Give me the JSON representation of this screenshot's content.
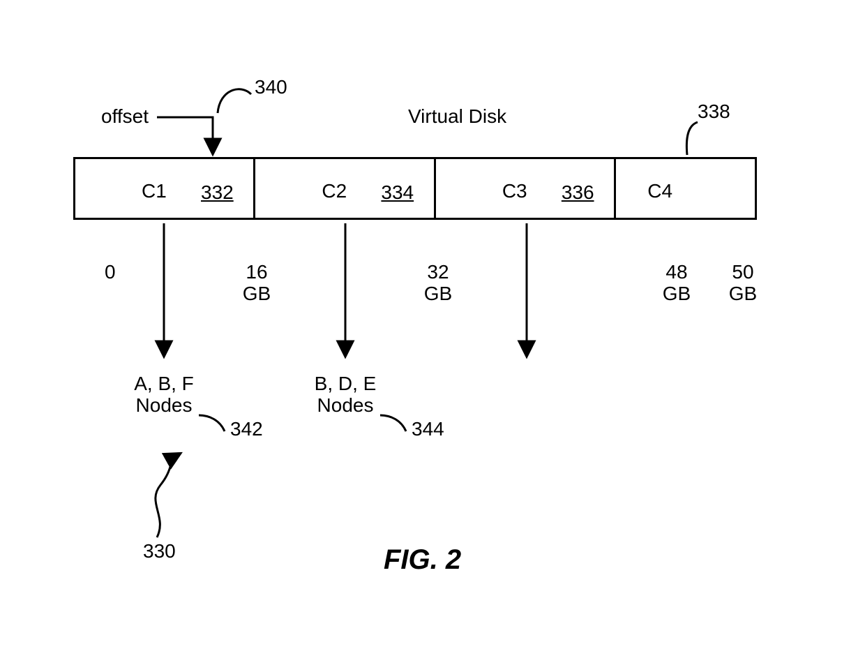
{
  "title": "Virtual Disk",
  "offset_label": "offset",
  "figure_caption": "FIG. 2",
  "chunks": [
    {
      "name": "C1",
      "ref": "332"
    },
    {
      "name": "C2",
      "ref": "334"
    },
    {
      "name": "C3",
      "ref": "336"
    },
    {
      "name": "C4",
      "ref": ""
    }
  ],
  "sizes": {
    "start": "0",
    "b1": "16\nGB",
    "b2": "32\nGB",
    "b3": "48\nGB",
    "b4": "50\nGB"
  },
  "nodes": {
    "c1": "A, B, F\nNodes",
    "c2": "B, D, E\nNodes"
  },
  "callouts": {
    "offset_ref": "340",
    "c4_ref": "338",
    "nodes1_ref": "342",
    "nodes2_ref": "344",
    "diagram_ref": "330"
  }
}
